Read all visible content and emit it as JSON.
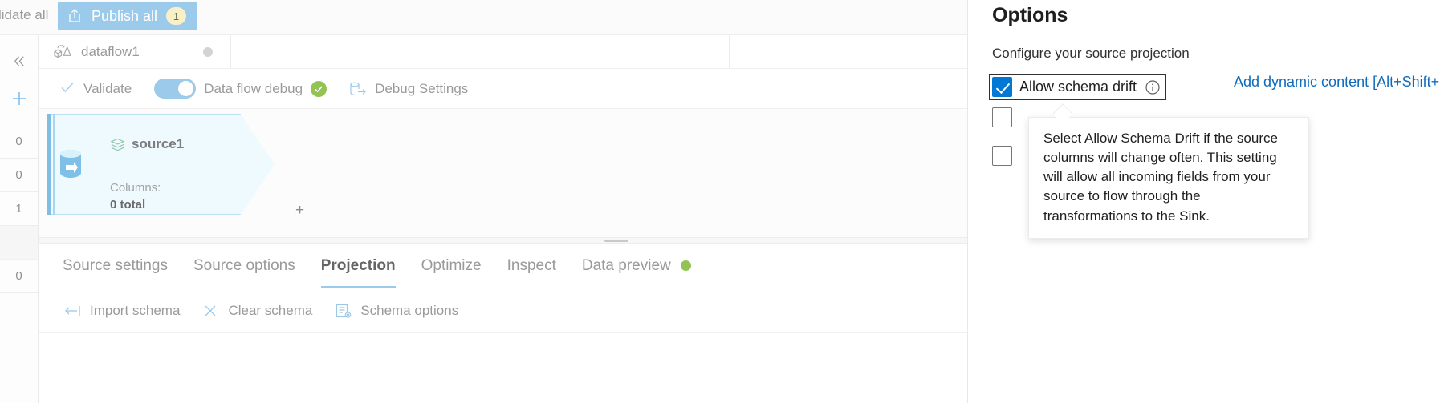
{
  "topbar": {
    "validate_all_label": "lidate all",
    "publish_all_label": "Publish all",
    "publish_badge_count": "1",
    "publish_icon": "upload-icon"
  },
  "left_rail": {
    "collapse_icon": "chevron-double-left-icon",
    "add_icon": "plus-icon",
    "counts": [
      "0",
      "0",
      "1",
      "",
      "0"
    ]
  },
  "dataflow_tab": {
    "icon": "dataflow-icon",
    "label": "dataflow1",
    "status_dot": "grey-status-dot"
  },
  "command_bar": {
    "validate_label": "Validate",
    "validate_icon": "checkmark-icon",
    "debug_toggle_label": "Data flow debug",
    "debug_toggle_on": true,
    "debug_status_icon": "green-check-circle-icon",
    "debug_settings_label": "Debug Settings",
    "debug_settings_icon": "debug-settings-icon"
  },
  "canvas": {
    "node": {
      "title": "source1",
      "title_icon": "source-stack-icon",
      "db_icon": "azure-database-icon",
      "columns_label": "Columns:",
      "columns_value": "0 total"
    },
    "add_node_glyph": "+"
  },
  "bottom_tabs": {
    "tabs": [
      {
        "label": "Source settings",
        "active": false
      },
      {
        "label": "Source options",
        "active": false
      },
      {
        "label": "Projection",
        "active": true
      },
      {
        "label": "Optimize",
        "active": false
      },
      {
        "label": "Inspect",
        "active": false
      },
      {
        "label": "Data preview",
        "active": false,
        "dot": "green-dot"
      }
    ]
  },
  "schema_bar": {
    "items": [
      {
        "label": "Import schema",
        "icon": "import-schema-icon"
      },
      {
        "label": "Clear schema",
        "icon": "close-x-icon"
      },
      {
        "label": "Schema options",
        "icon": "schema-options-icon"
      }
    ]
  },
  "options_panel": {
    "title": "Options",
    "subtitle": "Configure your source projection",
    "allow_schema_drift": {
      "label": "Allow schema drift",
      "checked": true,
      "info_icon": "info-circle-icon"
    },
    "dynamic_content_link": "Add dynamic content [Alt+Shift+D]",
    "tooltip_text": "Select Allow Schema Drift if the source columns will change often. This setting will allow all incoming fields from your source to flow through the transformations to the Sink.",
    "hidden_checkbox_1_checked": false,
    "hidden_checkbox_2_checked": false
  },
  "colors": {
    "accent_blue": "#0078d4",
    "link_blue": "#0f6cbd",
    "publish_blue": "#9ccaeb",
    "badge_yellow": "#faf0c8",
    "success_green": "#92c353",
    "node_fill": "#effaff",
    "node_border": "#bcdff2"
  }
}
